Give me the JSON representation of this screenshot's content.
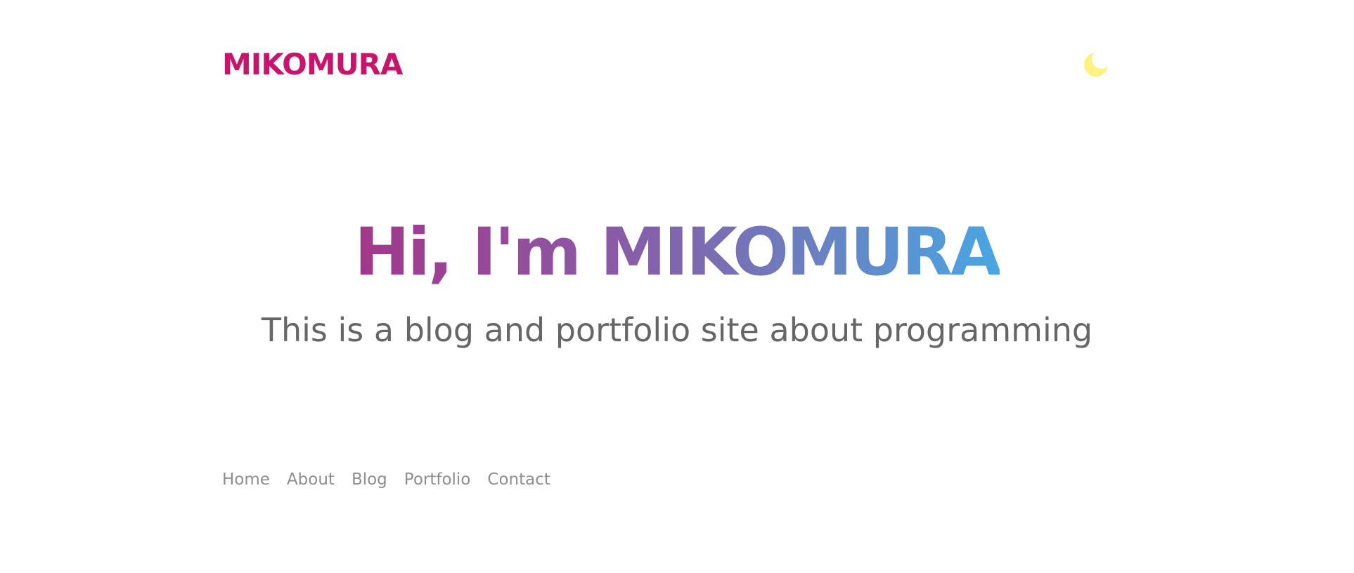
{
  "header": {
    "logo_text": "MIKOMURA",
    "theme_toggle_icon": "crescent-moon-icon",
    "theme_toggle_color": "#fdf17f"
  },
  "hero": {
    "title_prefix": "Hi, I'm ",
    "title_name": "MIKOMURA",
    "subtitle": "This is a blog and portfolio site about programming",
    "gradient_colors": [
      "#a3378b",
      "#8a5aa6",
      "#6b7fc0",
      "#49a6e3"
    ]
  },
  "nav": {
    "items": [
      {
        "label": "Home"
      },
      {
        "label": "About"
      },
      {
        "label": "Blog"
      },
      {
        "label": "Portfolio"
      },
      {
        "label": "Contact"
      }
    ]
  },
  "colors": {
    "brand": "#c8146b",
    "text_muted": "#666666",
    "nav_text": "#8e8e8e",
    "background": "#ffffff"
  }
}
